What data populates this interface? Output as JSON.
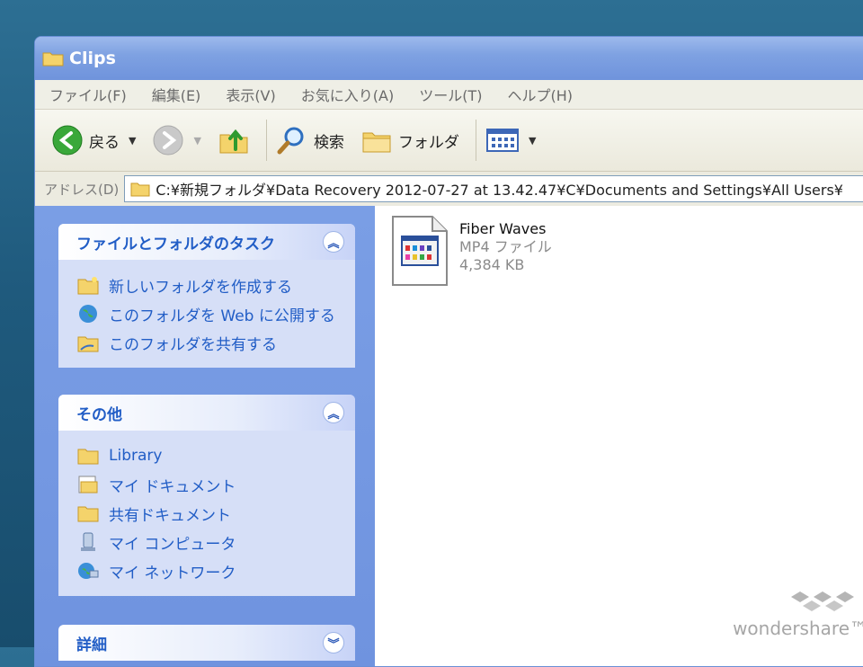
{
  "window": {
    "title": "Clips"
  },
  "menu": [
    "ファイル(F)",
    "編集(E)",
    "表示(V)",
    "お気に入り(A)",
    "ツール(T)",
    "ヘルプ(H)"
  ],
  "toolbar": {
    "back": "戻る",
    "search": "検索",
    "folders": "フォルダ"
  },
  "address": {
    "label": "アドレス(D)",
    "path": "C:¥新規フォルダ¥Data Recovery 2012-07-27 at 13.42.47¥C¥Documents and Settings¥All Users¥"
  },
  "panels": {
    "tasks": {
      "title": "ファイルとフォルダのタスク",
      "items": [
        "新しいフォルダを作成する",
        "このフォルダを Web に公開する",
        "このフォルダを共有する"
      ]
    },
    "other": {
      "title": "その他",
      "items": [
        "Library",
        "マイ ドキュメント",
        "共有ドキュメント",
        "マイ コンピュータ",
        "マイ ネットワーク"
      ]
    },
    "details": {
      "title": "詳細"
    }
  },
  "files": [
    {
      "name": "Fiber Waves",
      "type": "MP4 ファイル",
      "size": "4,384 KB"
    }
  ],
  "watermark": "wondershare™",
  "colors": {
    "task_link": "#215dc6",
    "sidepane": "#7a9ee5",
    "titlebar": "#7fa2e2"
  }
}
